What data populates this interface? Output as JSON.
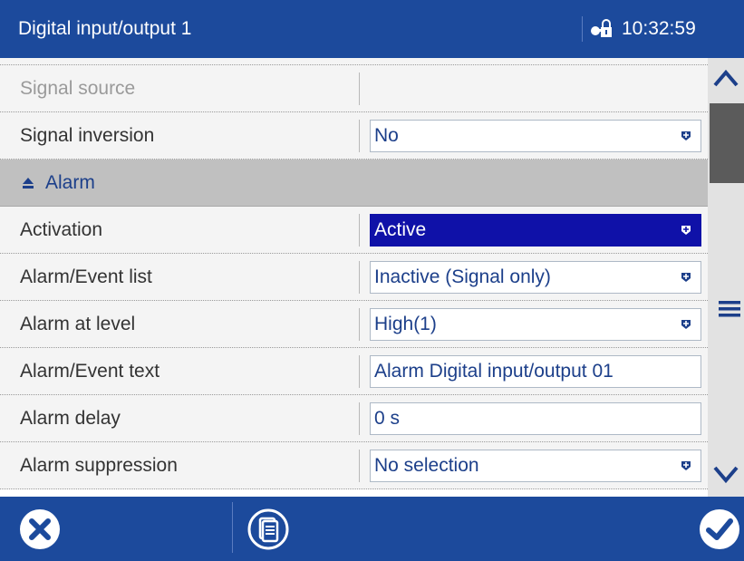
{
  "header": {
    "title": "Digital input/output 1",
    "clock": "10:32:59",
    "lock_icon": "lock-icon"
  },
  "rows": {
    "signal_source": {
      "label": "Signal source"
    },
    "signal_inversion": {
      "label": "Signal inversion",
      "value": "No"
    },
    "alarm_section": {
      "label": "Alarm"
    },
    "activation": {
      "label": "Activation",
      "value": "Active"
    },
    "alarm_event_list": {
      "label": "Alarm/Event list",
      "value": "Inactive (Signal only)"
    },
    "alarm_at_level": {
      "label": "Alarm at level",
      "value": "High(1)"
    },
    "alarm_event_text": {
      "label": "Alarm/Event text",
      "value": "Alarm Digital input/output 01"
    },
    "alarm_delay": {
      "label": "Alarm delay",
      "value": "0 s"
    },
    "alarm_suppression": {
      "label": "Alarm suppression",
      "value": "No selection"
    }
  },
  "footer": {
    "cancel_icon": "close-circle-icon",
    "help_icon": "document-icon",
    "ok_icon": "check-circle-icon"
  },
  "colors": {
    "header_blue": "#1c4a9c",
    "selected_field": "#0f11a8",
    "section_gray": "#c0c0c0",
    "value_text": "#1c3f8a"
  }
}
